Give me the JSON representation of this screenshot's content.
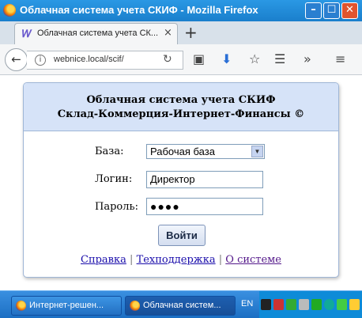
{
  "window": {
    "title": "Облачная система учета СКИФ - Mozilla Firefox"
  },
  "tab": {
    "title": "Облачная система учета СК...",
    "close_glyph": "×",
    "new_tab_glyph": "+"
  },
  "nav": {
    "url": "webnice.local/scif/"
  },
  "page": {
    "header_line1": "Облачная система учета СКИФ",
    "header_line2": "Склад-Коммерция-Интернет-Финансы ©",
    "base_label": "База:",
    "base_selected": "Рабочая база",
    "login_label": "Логин:",
    "login_value": "Директор",
    "password_label": "Пароль:",
    "password_masked": "●●●●",
    "submit_label": "Войти",
    "links": {
      "help": "Справка",
      "support": "Техподдержка",
      "about": "О системе",
      "separator": "|"
    }
  },
  "taskbar": {
    "tasks": [
      "Интернет-решен...",
      "Облачная систем..."
    ],
    "language": "EN"
  },
  "colors": {
    "accent": "#1f8fd6",
    "card_header": "#d6e3f8",
    "link": "#1a0dab"
  }
}
